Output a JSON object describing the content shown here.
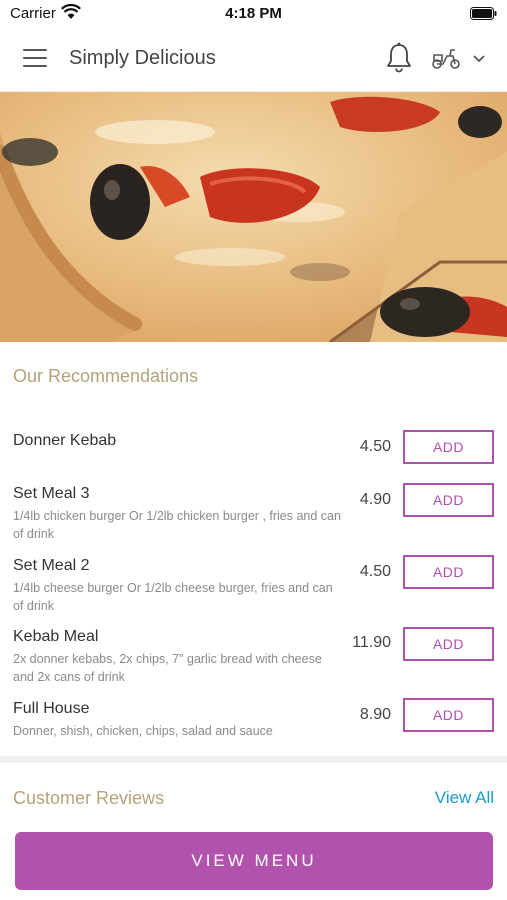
{
  "status_bar": {
    "carrier": "Carrier",
    "time": "4:18 PM"
  },
  "header": {
    "title": "Simply Delicious"
  },
  "recommendations": {
    "title": "Our Recommendations",
    "items": [
      {
        "name": "Donner Kebab",
        "description": "",
        "price": "4.50",
        "button": "ADD"
      },
      {
        "name": "Set Meal 3",
        "description": "1/4lb chicken burger Or 1/2lb chicken burger , fries and can of drink",
        "price": "4.90",
        "button": "ADD"
      },
      {
        "name": "Set Meal 2",
        "description": "1/4lb cheese burger Or 1/2lb cheese burger, fries and can of drink",
        "price": "4.50",
        "button": "ADD"
      },
      {
        "name": "Kebab Meal",
        "description": "2x donner kebabs, 2x chips, 7\" garlic bread with cheese and 2x cans of drink",
        "price": "11.90",
        "button": "ADD"
      },
      {
        "name": "Full House",
        "description": "Donner, shish, chicken, chips, salad and sauce",
        "price": "8.90",
        "button": "ADD"
      }
    ]
  },
  "reviews": {
    "title": "Customer Reviews",
    "view_all": "View All"
  },
  "footer": {
    "view_menu": "VIEW MENU"
  },
  "colors": {
    "accent": "#b152ad",
    "section_title": "#b4a27a",
    "link": "#1a9bd0"
  }
}
